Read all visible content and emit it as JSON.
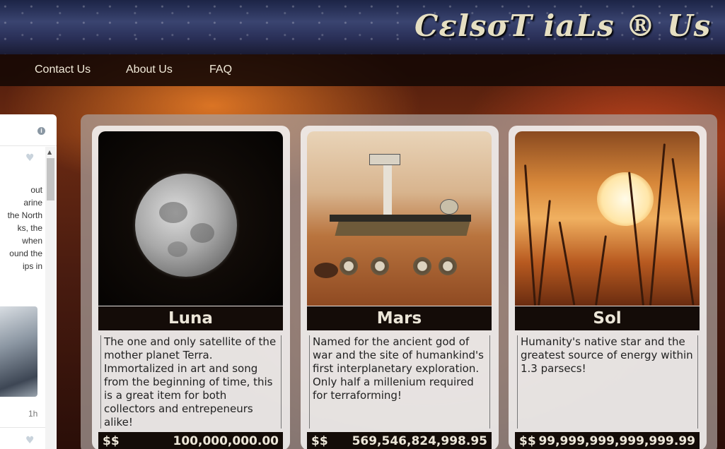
{
  "brand": {
    "logo_text": "CεlsσT iaLs ® Us"
  },
  "nav": {
    "items": [
      {
        "label": "Contact Us"
      },
      {
        "label": "About Us"
      },
      {
        "label": "FAQ"
      }
    ]
  },
  "widget": {
    "info_icon": "info-icon",
    "tweet_text": " out\narine\n the North\nks, the\n when\nound the\nips in",
    "time": "1h"
  },
  "products": [
    {
      "name": "Luna",
      "description": "The one and only satellite of the mother planet Terra. Immortalized in art and song from the beginning of time, this is a great item for both collectors and entrepeneurs alike!",
      "currency": "$$",
      "price": "100,000,000.00"
    },
    {
      "name": "Mars",
      "description": "Named for the ancient god of war and the site of humankind's first interplanetary exploration. Only half a millenium required for terraforming!",
      "currency": "$$",
      "price": "569,546,824,998.95"
    },
    {
      "name": "Sol",
      "description": "Humanity's native star and the greatest source of energy within 1.3 parsecs!",
      "currency": "$$",
      "price": "99,999,999,999,999.99"
    }
  ]
}
